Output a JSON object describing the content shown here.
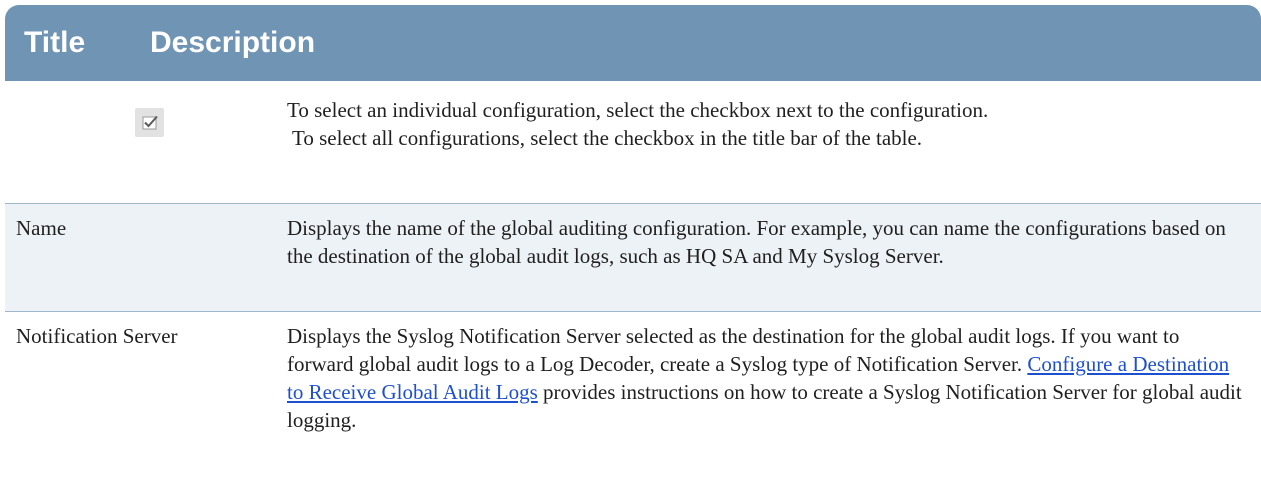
{
  "header": {
    "title": "Title",
    "description": "Description"
  },
  "rows": [
    {
      "title_icon": "checkbox-checked-icon",
      "description_lines": [
        "To select an individual configuration, select the checkbox next to the configuration.",
        "To select all configurations, select the checkbox in the title bar of the table."
      ]
    },
    {
      "title": "Name",
      "description": "Displays the name of the global auditing configuration. For example, you can name the configurations based on the destination of the global audit logs, such as HQ SA and My Syslog Server."
    },
    {
      "title": "Notification Server",
      "description_before": "Displays the Syslog Notification Server selected as the destination for the global audit logs. If you want to forward global audit logs to a Log Decoder, create a Syslog type of Notification Server. ",
      "link_text": "Configure a Destination to Receive Global Audit Logs",
      "description_after": " provides instructions on how to create a Syslog Notification Server for global audit logging."
    }
  ],
  "colors": {
    "header_bg": "#7094b4",
    "alt_row_bg": "#edf2f7",
    "link": "#1d4fd1"
  }
}
